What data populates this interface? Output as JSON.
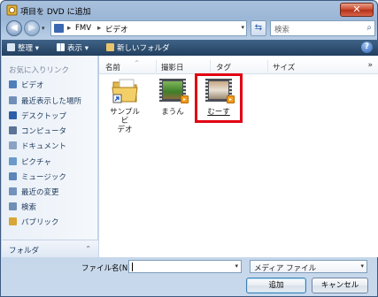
{
  "window": {
    "title": "項目を DVD に追加",
    "close_label": "✕"
  },
  "address": {
    "crumbs": [
      "FMV",
      "ビデオ"
    ],
    "search_placeholder": "検索"
  },
  "toolbar": {
    "organize_label": "整理 ▾",
    "view_label": "表示 ▾",
    "new_folder_label": "新しいフォルダ",
    "help_label": "?"
  },
  "nav": {
    "header": "お気に入りリンク",
    "items": [
      {
        "label": "ビデオ",
        "icon": "video-folder-icon",
        "color": "#4f7fb9"
      },
      {
        "label": "最近表示した場所",
        "icon": "recent-places-icon",
        "color": "#6f8fb8"
      },
      {
        "label": "デスクトップ",
        "icon": "desktop-icon",
        "color": "#2d5fa8"
      },
      {
        "label": "コンピュータ",
        "icon": "computer-icon",
        "color": "#5a7396"
      },
      {
        "label": "ドキュメント",
        "icon": "documents-icon",
        "color": "#8aa2c4"
      },
      {
        "label": "ピクチャ",
        "icon": "pictures-icon",
        "color": "#6a9acb"
      },
      {
        "label": "ミュージック",
        "icon": "music-icon",
        "color": "#5c86b8"
      },
      {
        "label": "最近の変更",
        "icon": "recent-changes-icon",
        "color": "#7292bd"
      },
      {
        "label": "検索",
        "icon": "search-folder-icon",
        "color": "#6e8fb6"
      },
      {
        "label": "パブリック",
        "icon": "public-folder-icon",
        "color": "#d8a536"
      }
    ],
    "folder_bar_label": "フォルダ",
    "folder_bar_chevron": "⌃"
  },
  "columns": [
    "名前",
    "撮影日",
    "タグ",
    "サイズ"
  ],
  "more_columns": "»",
  "files": [
    {
      "label_line1": "サンプル ビ",
      "label_line2": "デオ",
      "icon": "shortcut-folder-icon"
    },
    {
      "label_line1": "まうん",
      "label_line2": "",
      "icon": "video-file-icon"
    },
    {
      "label_line1": "むーす",
      "label_line2": "",
      "icon": "video-file-icon"
    }
  ],
  "bottom": {
    "filename_label": "ファイル名(N):",
    "filename_value": "",
    "filetype_value": "メディア ファイル",
    "add_label": "追加",
    "cancel_label": "キャンセル"
  },
  "colors": {
    "toolbar_top": "#3f6287",
    "toolbar_bottom": "#23405f",
    "highlight": "#e10012",
    "close_button": "#c9462a"
  }
}
